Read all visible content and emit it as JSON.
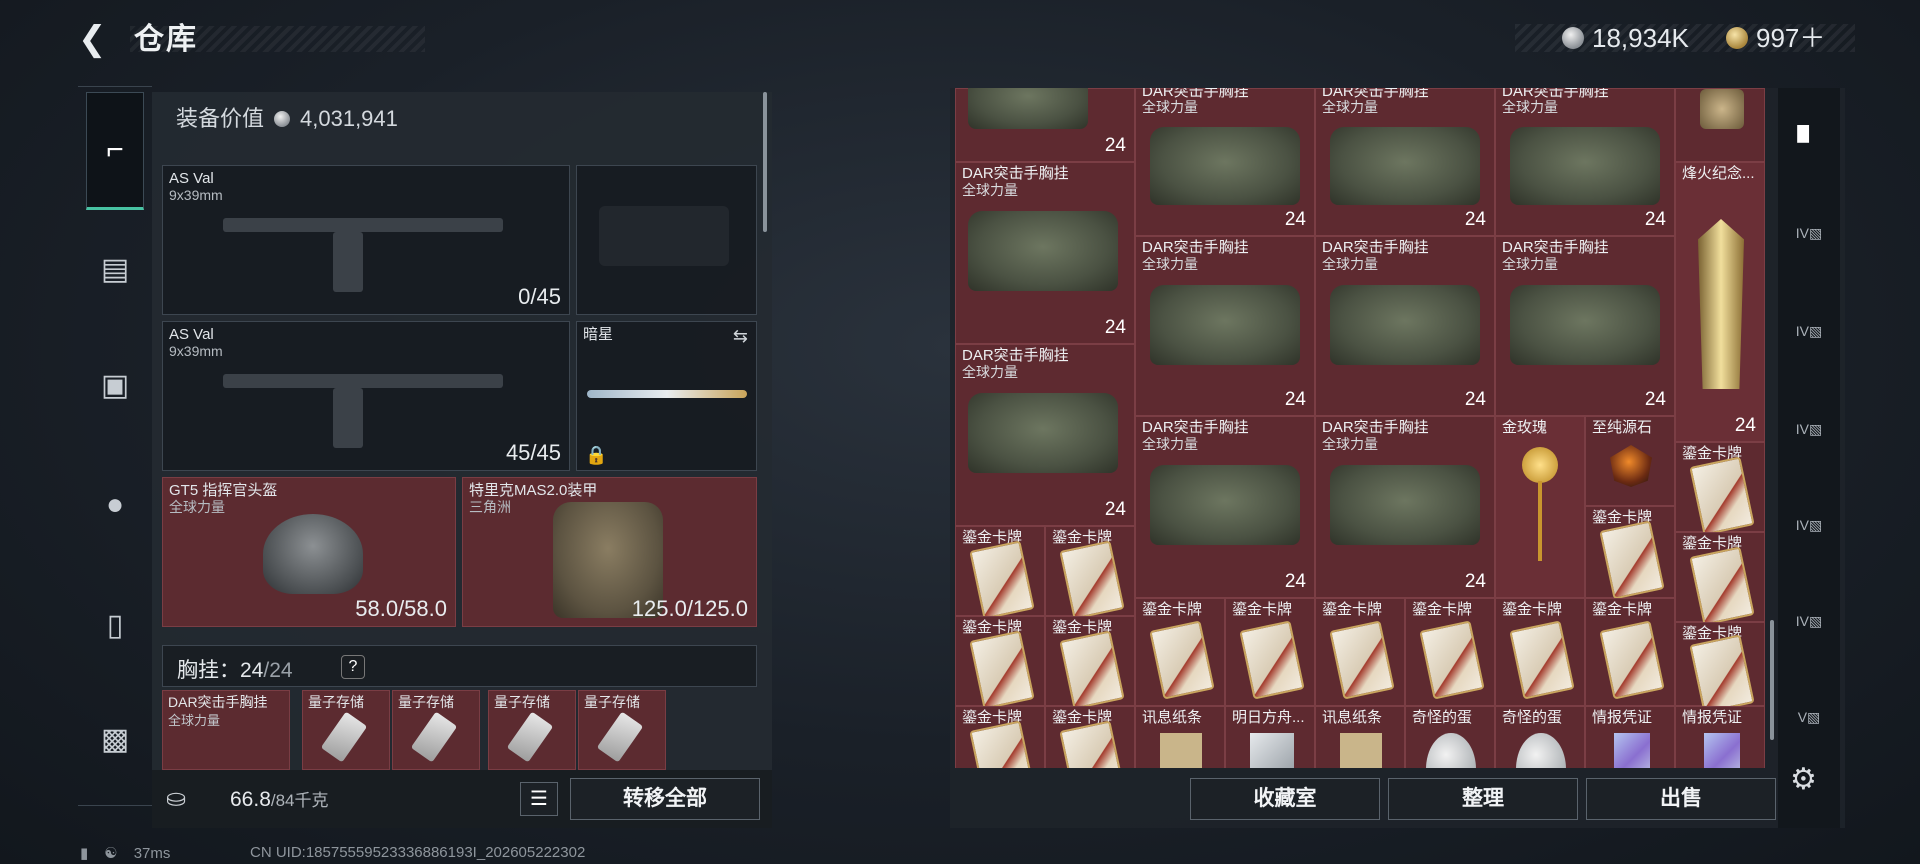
{
  "header": {
    "back_icon": "back-arrow-icon",
    "title": "仓库",
    "currencies": [
      {
        "icon": "silver-coin-icon",
        "value": "18,934K"
      },
      {
        "icon": "gold-coin-icon",
        "value": "997＋"
      }
    ]
  },
  "left_rail": [
    {
      "icon": "pistol-icon",
      "active": true
    },
    {
      "icon": "vest-icon"
    },
    {
      "icon": "armor-icon"
    },
    {
      "icon": "backpack-icon"
    },
    {
      "icon": "case-icon"
    },
    {
      "icon": "toolbox-icon"
    }
  ],
  "loadout": {
    "equip_value_label": "装备价值",
    "equip_value": "4,031,941",
    "primary": {
      "name": "AS Val",
      "caliber": "9x39mm",
      "ammo": "0/45"
    },
    "secondary": {
      "name": "AS Val",
      "caliber": "9x39mm",
      "ammo": "45/45"
    },
    "melee": {
      "name": "暗星"
    },
    "helmet": {
      "name": "GT5 指挥官头盔",
      "sub": "全球力量",
      "durability": "58.0/58.0"
    },
    "armor": {
      "name": "特里克MAS2.0装甲",
      "sub": "三角洲",
      "durability": "125.0/125.0"
    },
    "chest_label": "胸挂：",
    "chest_count": "24",
    "chest_max": "/24",
    "chest_help": "?",
    "chest_items": [
      {
        "name": "DAR突击手胸挂",
        "sub": "全球力量"
      },
      {
        "name": "量子存储"
      },
      {
        "name": "量子存储"
      },
      {
        "name": "量子存储"
      },
      {
        "name": "量子存储"
      }
    ],
    "weight": "66.8",
    "weight_max": "/84千克",
    "transfer_all": "转移全部"
  },
  "stash": {
    "bag_name": "DAR突击手胸挂",
    "bag_sub": "全球力量",
    "bag_count": "24",
    "trophy_name": "烽火纪念...",
    "rose_name": "金玫瑰",
    "stone_name": "至纯源石",
    "card_name": "鎏金卡牌",
    "note_name": "讯息纸条",
    "tomorrow_name": "明日方舟...",
    "egg_name": "奇怪的蛋",
    "intel_name": "情报凭证",
    "buttons": {
      "collection": "收藏室",
      "sort": "整理",
      "sell": "出售"
    }
  },
  "right_side": {
    "main_icon": "stash-icon",
    "tabs": [
      "IV",
      "IV",
      "IV",
      "IV",
      "IV",
      "V"
    ]
  },
  "status": {
    "ping": "37ms",
    "uid": "CN UID:18575559523336886193I_202605222302"
  }
}
